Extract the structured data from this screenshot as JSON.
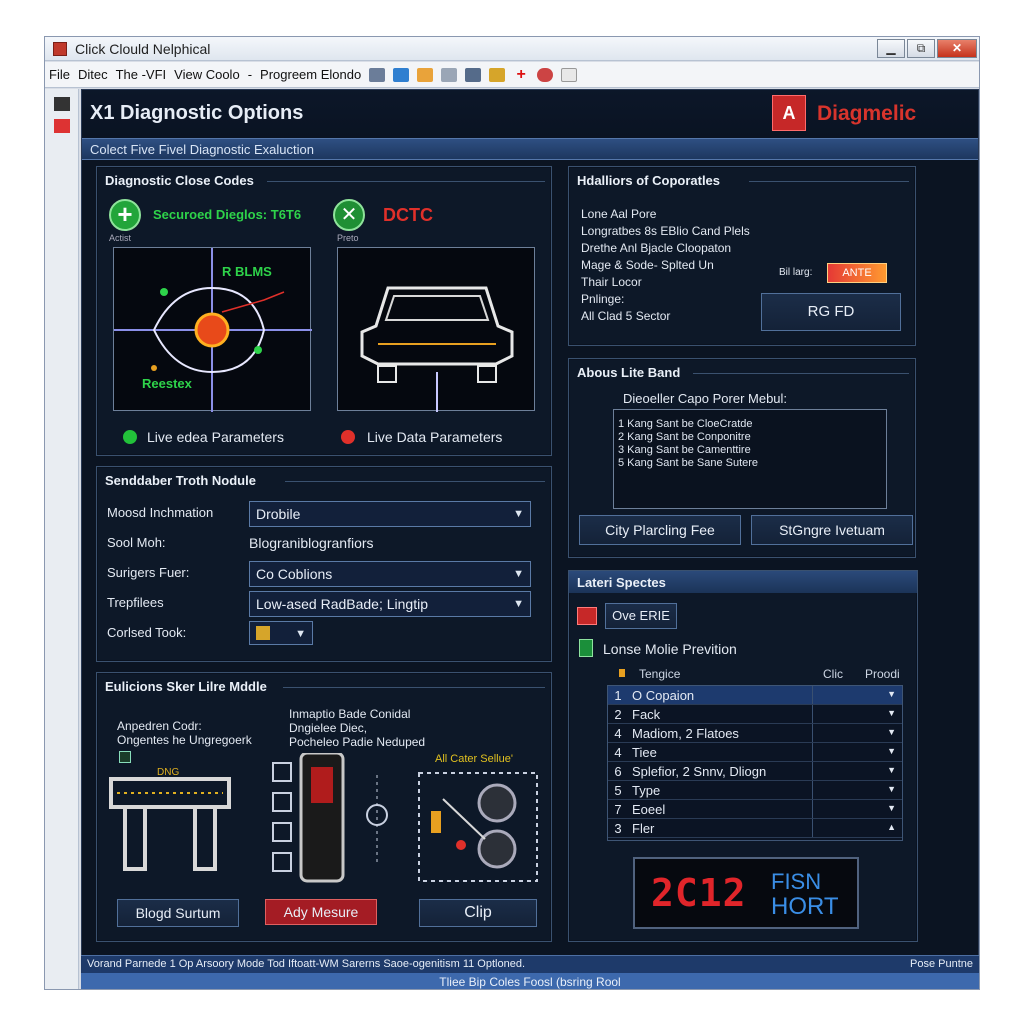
{
  "window": {
    "title": "Click Clould Nelphical",
    "minimize": "▁",
    "maximize": "⧉",
    "close": "✕"
  },
  "menu": {
    "items": [
      "File",
      "Ditec",
      "The -VFI",
      "View Coolo",
      "-",
      "Progreem Elondo"
    ]
  },
  "toolbar_icons": [
    "save-icon",
    "image-icon",
    "folder-icon",
    "link-icon",
    "print-icon",
    "gear-icon",
    "plus-icon",
    "target-icon",
    "refresh-icon"
  ],
  "header": {
    "title": "X1 Diagnostic Options",
    "brand": "Diagmelic",
    "logo_glyph": "A"
  },
  "subbar": {
    "text": "Colect Five Fivel Diagnostic Exaluction"
  },
  "dtc_panel": {
    "title": "Diagnostic Close Codes",
    "secured_text": "Securoed Dieglos: T6T6",
    "add_label": "Actist",
    "dtc_label": "DCTC",
    "dtc_sub": "Preto",
    "scope_top": "R BLMS",
    "scope_bottom": "Reestex",
    "live_left": "Live edea Parameters",
    "live_right": "Live Data Parameters"
  },
  "history_panel": {
    "title": "Hdalliors of Coporatles",
    "items": [
      "Lone Aal Pore",
      "Longratbes 8s EBlio Cand Plels",
      "Drethe Anl Bjacle Cloopaton",
      "Mage & Sode- Splted Un",
      "Thair Locor",
      "Pnlinge:",
      "All Clad 5 Sector"
    ],
    "badge_label": "Bil larg:",
    "badge_value": "ANTE",
    "button": "RG FD"
  },
  "about_panel": {
    "title": "Abous Lite Band",
    "subtitle": "Dieoeller Capo Porer Mebul:",
    "list": [
      "1  Kang Sant be CloeCratde",
      "2  Kang Sant be Conponitre",
      "3  Kang Sant be Camenttire",
      "5  Kang Sant be Sane Sutere"
    ],
    "btn_left": "City Plarcling Fee",
    "btn_right": "StGngre Ivetuam"
  },
  "settings_panel": {
    "title": "Senddaber Troth Nodule",
    "rows": [
      {
        "label": "Moosd Inchmation",
        "value": "Drobile",
        "type": "dropdown"
      },
      {
        "label": "Sool Moh:",
        "value": "Blograniblogranfiors",
        "type": "text"
      },
      {
        "label": "Surigers Fuer:",
        "value": "Co Coblions",
        "type": "dropdown"
      },
      {
        "label": "Trepfilees",
        "value": "Low-ased RadBade; Lingtip",
        "type": "dropdown"
      },
      {
        "label": "Corlsed Took:",
        "value": "",
        "type": "small-dropdown"
      }
    ]
  },
  "sensor_panel": {
    "title": "Eulicions Sker Lilre Mddle",
    "left_text": [
      "Anpedren Codr:",
      "Ongentes he Ungregoerk"
    ],
    "mid_text": [
      "Inmaptio Bade Conidal",
      "Dngielee Diec,",
      "Pocheleo Padie Neduped"
    ],
    "right_label": "All Cater Sellue'",
    "connector_label": "DNG",
    "btn_1": "Blogd Surtum",
    "btn_2": "Ady Mesure",
    "btn_3": "Clip"
  },
  "latest_panel": {
    "title": "Lateri Spectes",
    "opt_1": "Ove ERIE",
    "opt_2": "Lonse Molie Prevition",
    "col_1": "Tengice",
    "col_2": "Clic",
    "col_3": "Proodi",
    "rows": [
      {
        "n": "1",
        "t": "O Copaion"
      },
      {
        "n": "2",
        "t": "Fack"
      },
      {
        "n": "4",
        "t": "Madiom, 2 Flatoes"
      },
      {
        "n": "4",
        "t": "Tiee"
      },
      {
        "n": "6",
        "t": "Splefior, 2 Snnv, Dliogn"
      },
      {
        "n": "5",
        "t": "Type"
      },
      {
        "n": "7",
        "t": "Eoeel"
      },
      {
        "n": "3",
        "t": "Fler"
      }
    ],
    "display_code": "2C12",
    "display_l1": "FISN",
    "display_l2": "HORT"
  },
  "statusbar": {
    "left": "Vorand Parnede 1 Op Arsoory Mode Tod Iftoatt-WM Sarerns Saoe-ogenitism 11 Optloned.",
    "right": "Pose Puntne"
  },
  "footer": {
    "text": "Tliee Bip Coles Foosl (bsring Rool"
  },
  "colors": {
    "accent_blue": "#3d69ad",
    "panel_bg": "#0d1828",
    "green": "#22c13a",
    "red": "#e0302a"
  }
}
